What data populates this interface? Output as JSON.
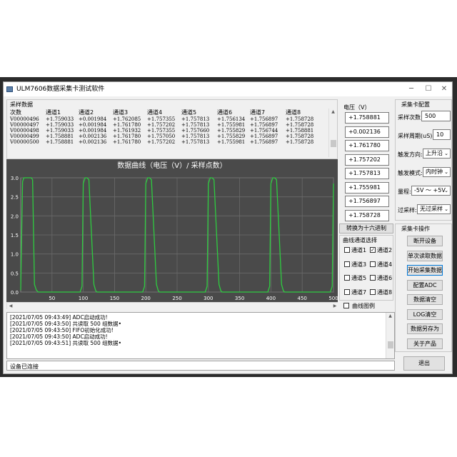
{
  "window": {
    "title": "ULM7606数据采集卡测试软件"
  },
  "sample_group": {
    "title": "采样数据",
    "columns": [
      "次数",
      "通道1",
      "通道2",
      "通道3",
      "通道4",
      "通道5",
      "通道6",
      "通道7",
      "通道8"
    ],
    "rows": [
      [
        "V00000496",
        "+1.759033",
        "+0.001984",
        "+1.762085",
        "+1.757355",
        "+1.757813",
        "+1.756134",
        "+1.756897",
        "+1.758728"
      ],
      [
        "V00000497",
        "+1.759033",
        "+0.001984",
        "+1.761780",
        "+1.757202",
        "+1.757813",
        "+1.755981",
        "+1.756897",
        "+1.758728"
      ],
      [
        "V00000498",
        "+1.759033",
        "+0.001984",
        "+1.761932",
        "+1.757355",
        "+1.757660",
        "+1.755829",
        "+1.756744",
        "+1.758881"
      ],
      [
        "V00000499",
        "+1.758881",
        "+0.002136",
        "+1.761780",
        "+1.757050",
        "+1.757813",
        "+1.755829",
        "+1.756897",
        "+1.758728"
      ],
      [
        "V00000500",
        "+1.758881",
        "+0.002136",
        "+1.761780",
        "+1.757202",
        "+1.757813",
        "+1.755981",
        "+1.756897",
        "+1.758728"
      ]
    ]
  },
  "voltage": {
    "title": "电压（V）",
    "values": [
      "+1.758881",
      "+0.002136",
      "+1.761780",
      "+1.757202",
      "+1.757813",
      "+1.755981",
      "+1.756897",
      "+1.758728"
    ]
  },
  "hex_button": "转换为十六进制",
  "channel_select": {
    "title": "曲线通道选择",
    "items": [
      {
        "label": "通道1",
        "checked": false
      },
      {
        "label": "通道2",
        "checked": true
      },
      {
        "label": "通道3",
        "checked": false
      },
      {
        "label": "通道4",
        "checked": false
      },
      {
        "label": "通道5",
        "checked": false
      },
      {
        "label": "通道6",
        "checked": false
      },
      {
        "label": "通道7",
        "checked": false
      },
      {
        "label": "通道8",
        "checked": false
      }
    ],
    "legend_label": "曲线图例",
    "legend_checked": false
  },
  "config": {
    "title": "采集卡配置",
    "sample_count_label": "采样次数:",
    "sample_count_value": "500",
    "sample_period_label": "采样周期(uS):",
    "sample_period_value": "10",
    "trigger_dir_label": "触发方向:",
    "trigger_dir_value": "上升沿",
    "trigger_mode_label": "触发模式:",
    "trigger_mode_value": "内时钟",
    "range_label": "量程:",
    "range_value": "-5V ～ +5V",
    "oversample_label": "过采样:",
    "oversample_value": "无过采样"
  },
  "ops": {
    "title": "采集卡操作",
    "buttons": [
      "断开设备",
      "单次读取数据",
      "开始采集数据",
      "配置ADC",
      "数据清空",
      "LOG清空",
      "数据另存为",
      "关于产品"
    ],
    "exit": "退出"
  },
  "log": [
    "[2021/07/05 09:43:49] ADC启动成功!",
    "[2021/07/05 09:43:50] 共读取 500 组数据•",
    "[2021/07/05 09:43:50] FIFO初始化成功!",
    "[2021/07/05 09:43:50] ADC启动成功!",
    "[2021/07/05 09:43:51] 共读取 500 组数据•"
  ],
  "status": "设备已连接",
  "chart_data": {
    "type": "line",
    "title": "数据曲线（电压（V）/ 采样点数）",
    "xlim": [
      0,
      500
    ],
    "ylim": [
      0,
      3.0
    ],
    "x_ticks": [
      50,
      100,
      150,
      200,
      250,
      300,
      350,
      400,
      450,
      500
    ],
    "y_ticks": [
      0.0,
      0.5,
      1.0,
      1.5,
      2.0,
      2.5,
      3.0
    ],
    "grid": true,
    "colors": {
      "background": "#4a4a4a",
      "grid": "#6a6a6a",
      "line": "#2ecc40"
    },
    "series": [
      {
        "x": [
          0,
          3,
          5,
          17,
          19,
          22,
          25,
          28,
          95,
          98,
          100,
          103,
          106,
          109,
          117,
          120,
          122,
          195,
          198,
          200,
          203,
          206,
          209,
          217,
          220,
          222,
          295,
          298,
          300,
          303,
          306,
          309,
          317,
          320,
          322,
          395,
          398,
          400,
          403,
          406,
          409,
          417,
          420,
          422,
          495,
          498,
          500
        ],
        "y": [
          0.05,
          2.9,
          3.0,
          3.0,
          2.95,
          0.2,
          0.05,
          0.0,
          0.0,
          0.15,
          2.85,
          3.0,
          3.0,
          2.95,
          0.2,
          0.03,
          0.0,
          0.0,
          0.15,
          2.85,
          3.0,
          3.0,
          2.95,
          0.2,
          0.03,
          0.0,
          0.0,
          0.15,
          2.85,
          3.0,
          3.0,
          2.95,
          0.2,
          0.03,
          0.0,
          0.0,
          0.15,
          2.85,
          3.0,
          3.0,
          2.95,
          0.2,
          0.03,
          0.0,
          0.0,
          0.15,
          2.85
        ]
      }
    ]
  }
}
